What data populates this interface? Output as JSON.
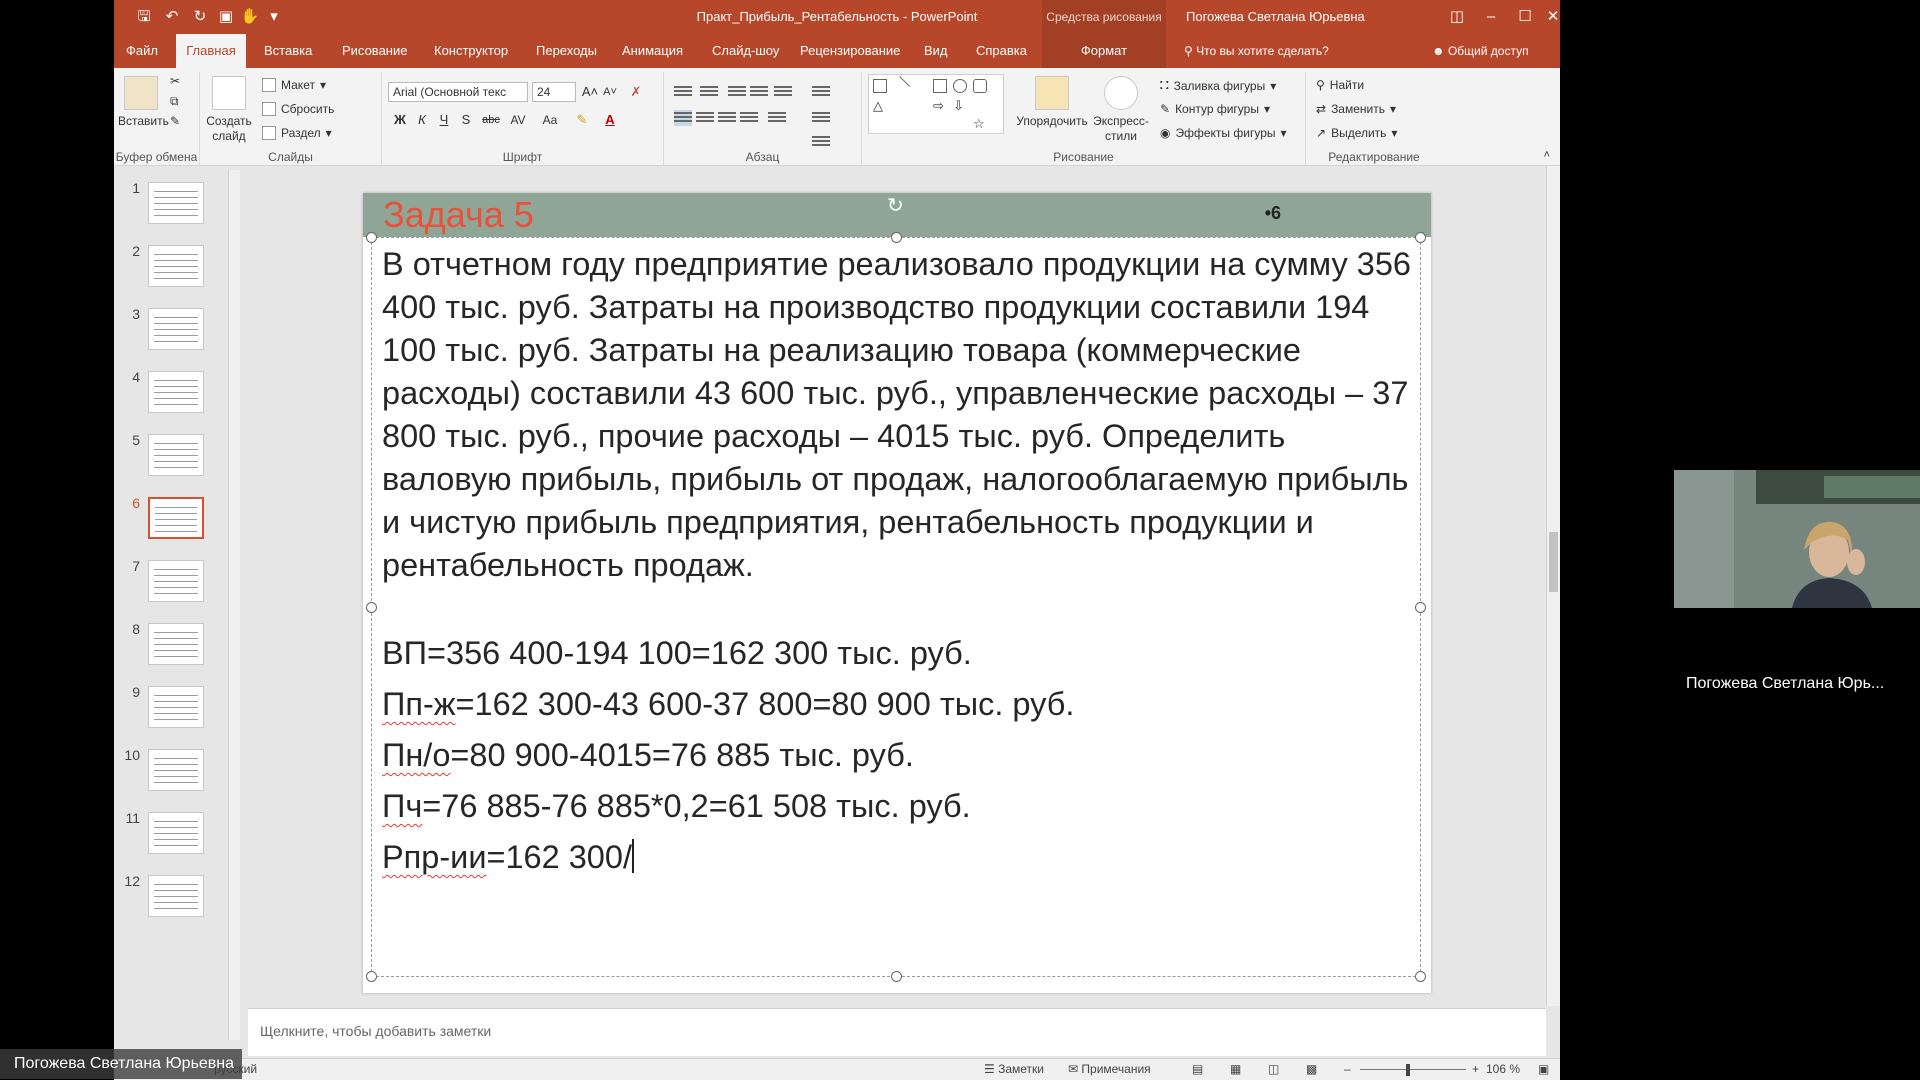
{
  "titlebar": {
    "doc_title": "Практ_Прибыль_Рентабельность - PowerPoint",
    "contextual": "Средства рисования",
    "user": "Погожева Светлана Юрьевна"
  },
  "tabs": {
    "file": "Файл",
    "home": "Главная",
    "insert": "Вставка",
    "draw": "Рисование",
    "design": "Конструктор",
    "transitions": "Переходы",
    "animation": "Анимация",
    "slideshow": "Слайд-шоу",
    "review": "Рецензирование",
    "view": "Вид",
    "help": "Справка",
    "format": "Формат",
    "tell_me": "Что вы хотите сделать?",
    "share": "Общий доступ"
  },
  "ribbon": {
    "clipboard": {
      "paste": "Вставить",
      "label": "Буфер обмена"
    },
    "slides": {
      "new_slide_1": "Создать",
      "new_slide_2": "слайд",
      "layout": "Макет",
      "reset": "Сбросить",
      "section": "Раздел",
      "label": "Слайды"
    },
    "font": {
      "font_name": "Arial (Основной текс",
      "font_size": "24",
      "bold": "Ж",
      "italic": "К",
      "underline": "Ч",
      "shadow": "S",
      "strike": "abc",
      "spacing": "AV",
      "case": "Aa",
      "label": "Шрифт"
    },
    "paragraph": {
      "label": "Абзац"
    },
    "drawing": {
      "arrange_1": "Упорядочить",
      "quick_1": "Экспресс-",
      "quick_2": "стили",
      "fill": "Заливка фигуры",
      "outline": "Контур фигуры",
      "effects": "Эффекты фигуры",
      "label": "Рисование"
    },
    "editing": {
      "find": "Найти",
      "replace": "Заменить",
      "select": "Выделить",
      "label": "Редактирование"
    }
  },
  "thumbnails": [
    "1",
    "2",
    "3",
    "4",
    "5",
    "6",
    "7",
    "8",
    "9",
    "10",
    "11",
    "12"
  ],
  "selected_slide": "6",
  "slide": {
    "title": "Задача 5",
    "number": "•6",
    "problem": "В отчетном году предприятие реализовало продукции на сумму 356 400 тыс. руб. Затраты на производство продукции составили 194 100 тыс. руб. Затраты на реализацию товара (коммерческие расходы) составили 43 600 тыс. руб., управленческие расходы – 37 800 тыс. руб., прочие расходы – 4015 тыс. руб. Определить валовую прибыль, прибыль от продаж, налогооблагаемую прибыль и чистую прибыль предприятия, рентабельность продукции и рентабельность продаж.",
    "calc_vp": "ВП=356 400-194 100=162 300 тыс. руб.",
    "calc_pp_prefix": "Пп-ж",
    "calc_pp_rest": "=162 300-43 600-37 800=80 900 тыс. руб.",
    "calc_pn_prefix": "Пн/о",
    "calc_pn_rest": "=80 900-4015=76 885 тыс. руб.",
    "calc_pch_prefix": "Пч",
    "calc_pch_rest": "=76 885-76 885*0,2=61 508 тыс. руб.",
    "calc_rpr_prefix": "Рпр-ии",
    "calc_rpr_rest": "=162 300/"
  },
  "notes_placeholder": "Щелкните, чтобы добавить заметки",
  "status": {
    "language": "русский",
    "notes": "Заметки",
    "comments": "Примечания",
    "zoom": "106 %"
  },
  "video": {
    "participant": "Погожева Светлана Юрь...",
    "presenter": "Погожева Светлана Юрьевна"
  },
  "colors": {
    "accent": "#b7472a",
    "title_band": "#8fa595",
    "title_text": "#e8523a"
  }
}
